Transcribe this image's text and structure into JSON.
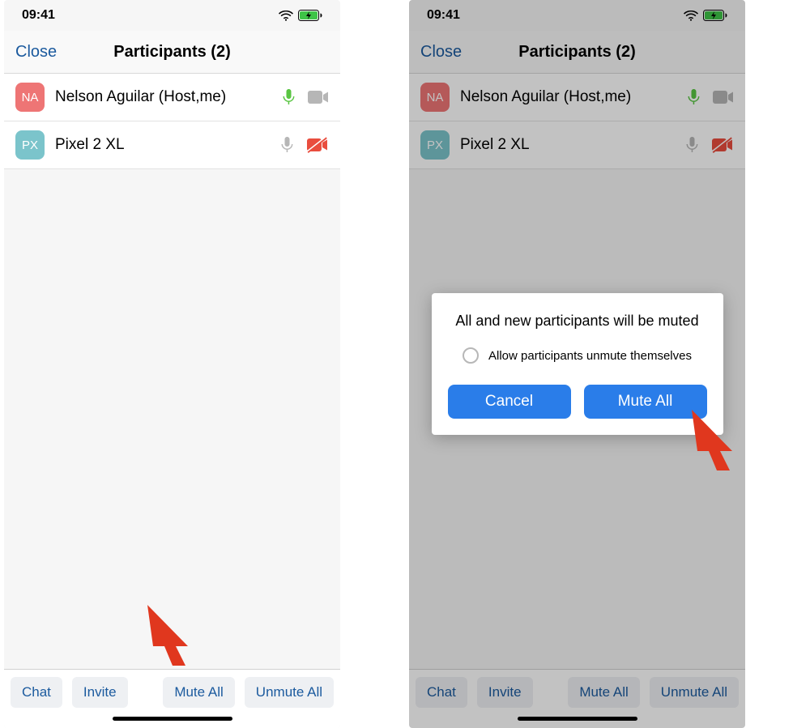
{
  "status": {
    "time": "09:41"
  },
  "nav": {
    "close": "Close",
    "title": "Participants (2)"
  },
  "participants": [
    {
      "initials": "NA",
      "name": "Nelson Aguilar (Host,me)",
      "mic_active": true,
      "cam_active": true,
      "cam_disabled": false
    },
    {
      "initials": "PX",
      "name": "Pixel 2 XL",
      "mic_active": false,
      "cam_active": false,
      "cam_disabled": true
    }
  ],
  "bottom": {
    "chat": "Chat",
    "invite": "Invite",
    "mute_all": "Mute All",
    "unmute_all": "Unmute All"
  },
  "dialog": {
    "title": "All and new participants will be muted",
    "checkbox_label": "Allow participants unmute themselves",
    "cancel": "Cancel",
    "confirm": "Mute All"
  }
}
